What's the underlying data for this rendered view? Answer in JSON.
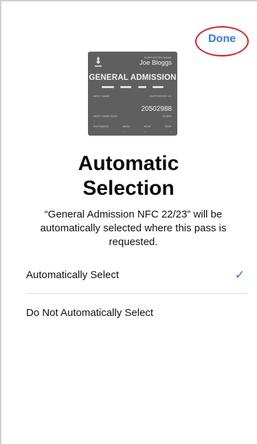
{
  "header": {
    "done_label": "Done"
  },
  "pass": {
    "supporter_name_label": "SUPPORTER NAME",
    "supporter_name": "Joe Bloggs",
    "ticket_type": "GENERAL ADMISSION",
    "next_game_label": "NEXT GAME",
    "next_game_value": "–",
    "supporter_id_label": "SUPPORTER I.D.",
    "supporter_id": "20502988",
    "next_game_date_label": "NEXT GAME DATE",
    "next_game_date_value": "–",
    "stand_label": "STAND",
    "stand_value": "–",
    "entrance_label": "ENTRANCE",
    "entrance_value": "–",
    "area_label": "AREA",
    "area_value": "–",
    "row_label": "ROW",
    "row_value": "–",
    "seat_label": "SEAT",
    "seat_value": "–"
  },
  "main": {
    "title_line1": "Automatic",
    "title_line2": "Selection",
    "description": "“General Admission NFC 22/23” will be automatically selected where this pass is requested."
  },
  "options": [
    {
      "label": "Automatically Select",
      "selected": true,
      "icon": "checkmark-icon"
    },
    {
      "label": "Do Not Automatically Select",
      "selected": false
    }
  ],
  "colors": {
    "accent": "#2f7ae5",
    "highlight_ring": "#d6202a",
    "pass_background": "#5f5f5f"
  }
}
